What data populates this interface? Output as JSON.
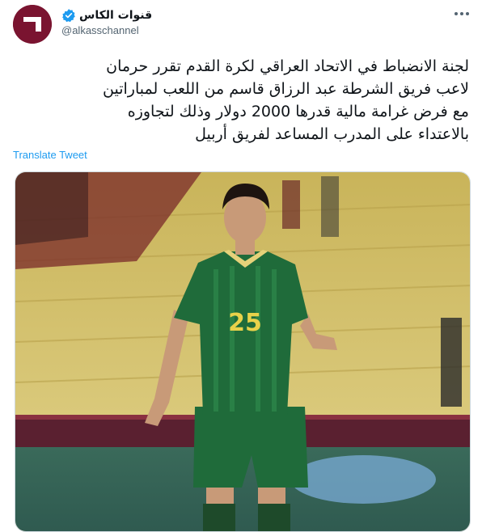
{
  "header": {
    "display_name": "قنوات الكاس",
    "handle": "@alkasschannel",
    "avatar_icon": "alkass-logo-icon",
    "verified_icon": "verified-badge-icon",
    "more_icon": "more-options-icon",
    "colors": {
      "avatar_bg": "#7a1430",
      "verified": "#1d9bf0"
    }
  },
  "tweet": {
    "lines": [
      "لجنة الانضباط في الاتحاد العراقي لكرة القدم تقرر حرمان",
      "لاعب فريق الشرطة عبد الرزاق قاسم من اللعب لمباراتين",
      "مع فرض غرامة مالية قدرها 2000 دولار وذلك لتجاوزه",
      "بالاعتداء على المدرب المساعد لفريق أربيل"
    ],
    "translate_label": "Translate Tweet"
  },
  "media": {
    "description_icon": "football-player-photo",
    "jersey_number": "25",
    "colors": {
      "jersey": "#1f6b3a",
      "stands": "#d9c66a",
      "pitch_band": "#5a2030"
    }
  }
}
